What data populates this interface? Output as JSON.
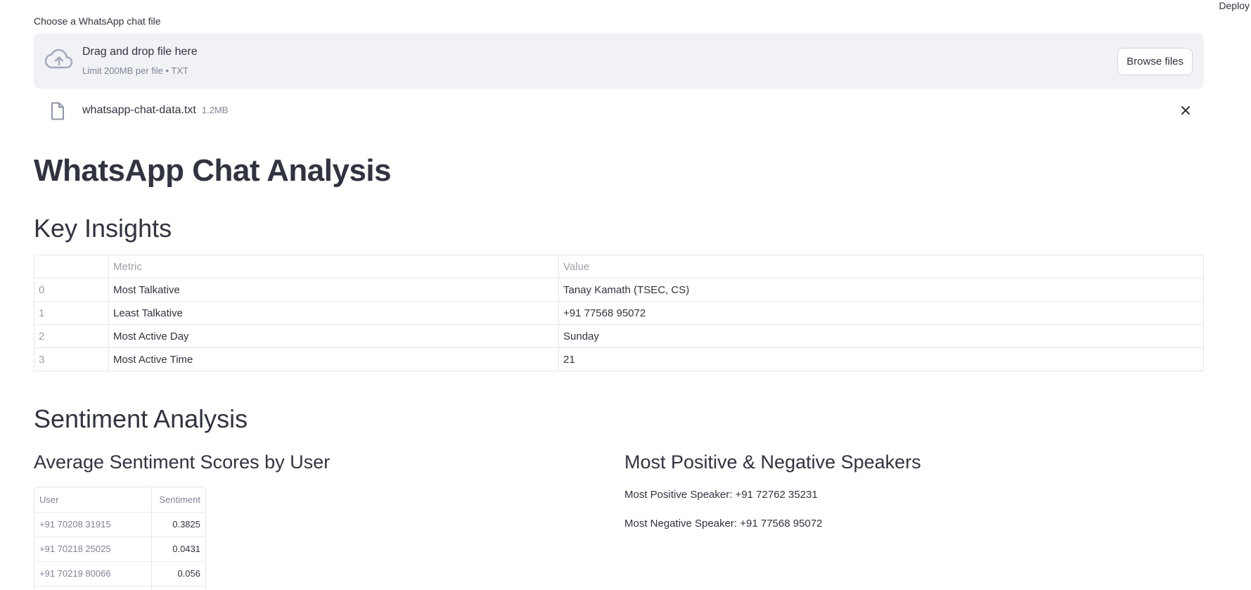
{
  "header": {
    "deploy_label": "Deploy"
  },
  "uploader": {
    "label": "Choose a WhatsApp chat file",
    "drop_title": "Drag and drop file here",
    "drop_sub": "Limit 200MB per file • TXT",
    "browse_label": "Browse files",
    "icons": {
      "upload": "cloud-upload-icon",
      "file": "file-icon",
      "remove": "close-icon"
    },
    "file": {
      "name": "whatsapp-chat-data.txt",
      "size": "1.2MB"
    }
  },
  "title": "WhatsApp Chat Analysis",
  "key_insights": {
    "heading": "Key Insights",
    "columns": [
      "",
      "Metric",
      "Value"
    ],
    "rows": [
      {
        "index": "0",
        "metric": "Most Talkative",
        "value": "Tanay Kamath (TSEC, CS)"
      },
      {
        "index": "1",
        "metric": "Least Talkative",
        "value": "+91 77568 95072"
      },
      {
        "index": "2",
        "metric": "Most Active Day",
        "value": "Sunday"
      },
      {
        "index": "3",
        "metric": "Most Active Time",
        "value": "21"
      }
    ]
  },
  "sentiment": {
    "heading": "Sentiment Analysis",
    "avg_heading": "Average Sentiment Scores by User",
    "columns": [
      "User",
      "Sentiment"
    ],
    "rows": [
      {
        "user": "+91 70208 31915",
        "score": "0.3825"
      },
      {
        "user": "+91 70218 25025",
        "score": "0.0431"
      },
      {
        "user": "+91 70219 80066",
        "score": "0.056"
      }
    ],
    "speakers_heading": "Most Positive & Negative Speakers",
    "most_positive": "Most Positive Speaker: +91 72762 35231",
    "most_negative": "Most Negative Speaker: +91 77568 95072"
  }
}
